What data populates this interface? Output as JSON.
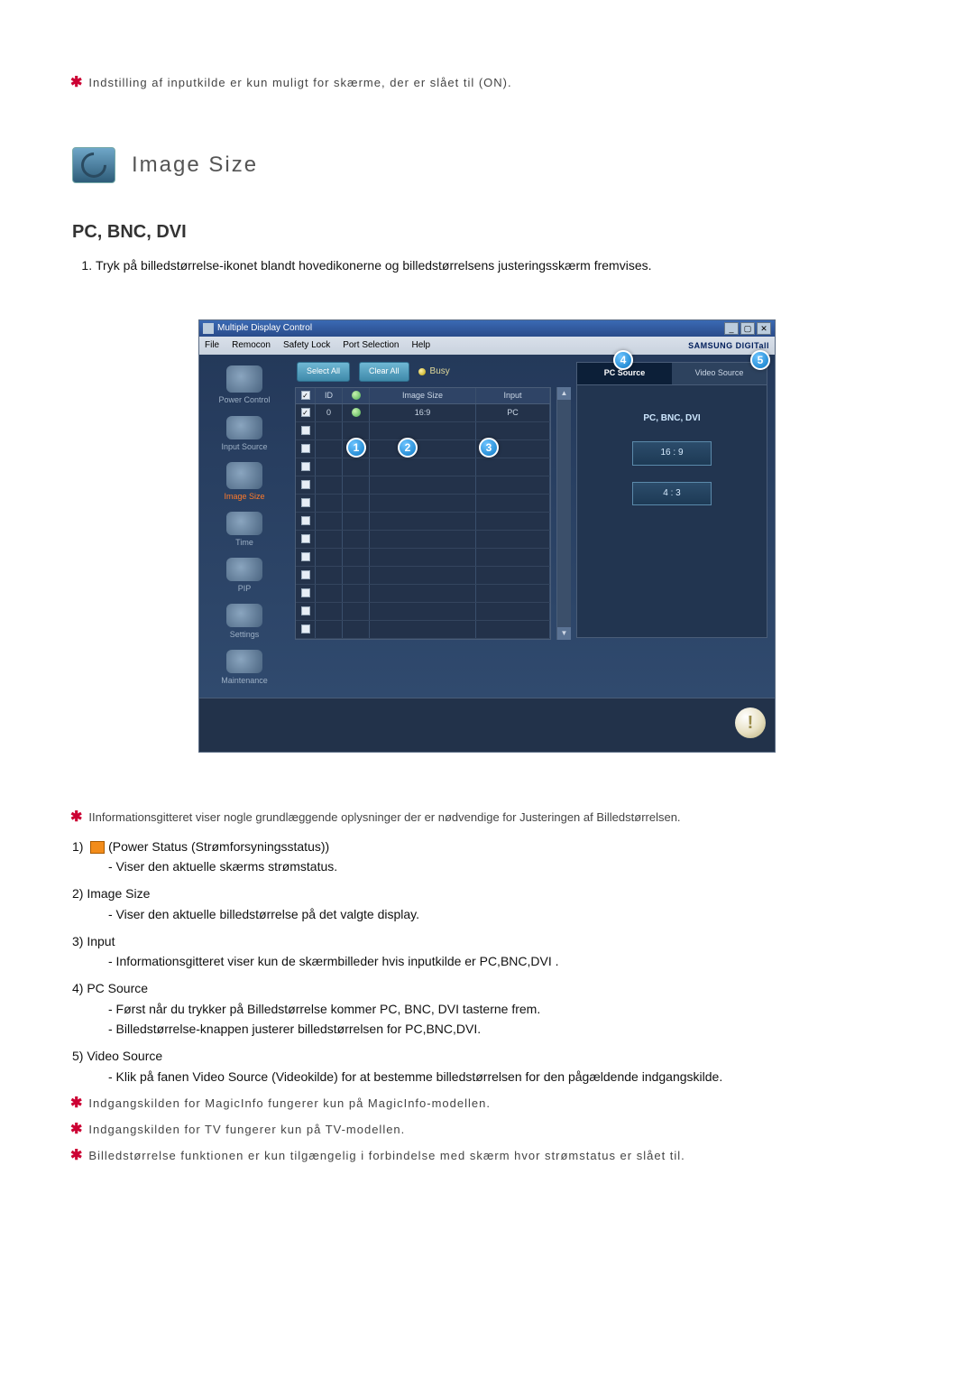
{
  "top_note": "Indstilling af inputkilde er kun muligt for skærme, der er slået til (ON).",
  "heading": "Image Size",
  "subheading": "PC, BNC, DVI",
  "intro_num": "1.",
  "intro_text": "Tryk på billedstørrelse-ikonet blandt hovedikonerne og billedstørrelsens justeringsskærm fremvises.",
  "app": {
    "title": "Multiple Display Control",
    "brand": "SAMSUNG DIGITall",
    "menu": {
      "file": "File",
      "remocon": "Remocon",
      "safety": "Safety Lock",
      "port": "Port Selection",
      "help": "Help"
    },
    "sidebar": {
      "power": "Power Control",
      "input": "Input Source",
      "image": "Image Size",
      "time": "Time",
      "pip": "PIP",
      "settings": "Settings",
      "maint": "Maintenance"
    },
    "buttons": {
      "select_all": "Select All",
      "clear_all": "Clear All",
      "busy": "Busy"
    },
    "table": {
      "cols": {
        "id": "ID",
        "image_size": "Image Size",
        "input": "Input"
      },
      "row0": {
        "id": "0",
        "image_size": "16:9",
        "input": "PC"
      }
    },
    "tabs": {
      "pc": "PC Source",
      "video": "Video Source"
    },
    "pane": {
      "head": "PC, BNC, DVI",
      "r169": "16 : 9",
      "r43": "4 : 3"
    },
    "callouts": {
      "c1": "1",
      "c2": "2",
      "c3": "3",
      "c4": "4",
      "c5": "5"
    }
  },
  "desc": {
    "line0": "IInformationsgitteret viser nogle grundlæggende oplysninger der er nødvendige for Justeringen af Billedstørrelsen.",
    "n1": "1)",
    "t1": "(Power Status (Strømforsyningsstatus))",
    "s1": "- Viser den aktuelle skærms strømstatus.",
    "n2": "2)",
    "t2": "Image Size",
    "s2": "- Viser den aktuelle billedstørrelse på det valgte display.",
    "n3": "3)",
    "t3": "Input",
    "s3": "- Informationsgitteret viser kun de skærmbilleder hvis inputkilde er PC,BNC,DVI .",
    "n4": "4)",
    "t4": "PC Source",
    "s4a": "- Først når du trykker på Billedstørrelse kommer PC, BNC, DVI tasterne frem.",
    "s4b": "- Billedstørrelse-knappen justerer billedstørrelsen for PC,BNC,DVI.",
    "n5": "5)",
    "t5": "Video Source",
    "s5": "- Klik på fanen Video Source (Videokilde) for at bestemme billedstørrelsen for den pågældende indgangskilde.",
    "foot1": "Indgangskilden for MagicInfo fungerer kun på MagicInfo-modellen.",
    "foot2": "Indgangskilden for TV fungerer kun på TV-modellen.",
    "foot3": "Billedstørrelse funktionen er kun tilgængelig i forbindelse med skærm hvor strømstatus er slået til."
  }
}
